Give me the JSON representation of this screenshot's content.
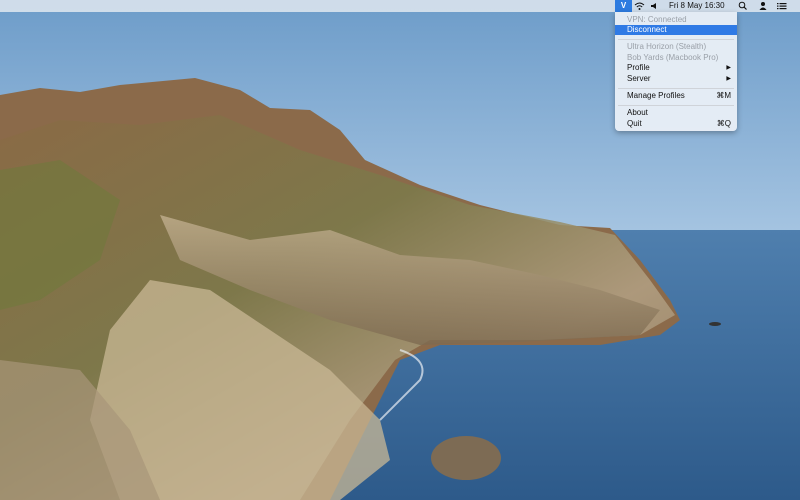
{
  "menubar": {
    "vpn_icon": "shield-v-icon",
    "vpn_glyph": "V",
    "wifi_icon": "wifi-icon",
    "volume_icon": "speaker-icon",
    "clock": "Fri 8 May  16:30",
    "search_icon": "magnifier-icon",
    "user_icon": "user-icon",
    "list_icon": "list-icon"
  },
  "menu": {
    "status": "VPN: Connected",
    "disconnect": "Disconnect",
    "profile_name": "Ultra Horizon (Stealth)",
    "device_name": "Bob Yards (Macbook Pro)",
    "profile": "Profile",
    "server": "Server",
    "manage_profiles": "Manage Profiles",
    "manage_shortcut": "⌘M",
    "about": "About",
    "quit": "Quit",
    "quit_shortcut": "⌘Q",
    "submenu_arrow": "▶"
  }
}
